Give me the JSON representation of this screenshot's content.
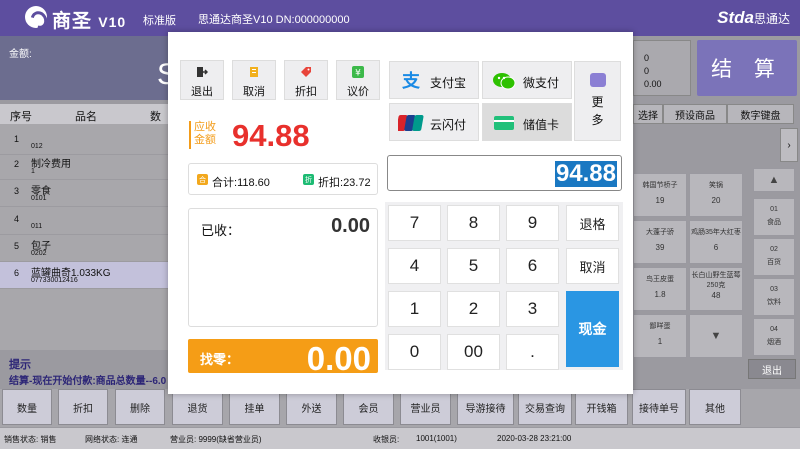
{
  "topbar": {
    "brand": "商圣",
    "version": "V10",
    "edition": "标准版",
    "title": "思通达商圣V10 DN:000000000",
    "logo_right": "Stda",
    "logo_right_cn": "思通达"
  },
  "background": {
    "amount_label": "金额:",
    "amount_partial": "S",
    "list_headers": {
      "seq": "序号",
      "name": "品名",
      "qty": "数量"
    },
    "rows": [
      {
        "no": "1",
        "name": "",
        "code": "012"
      },
      {
        "no": "2",
        "name": "制冷费用",
        "code": "1"
      },
      {
        "no": "3",
        "name": "零食",
        "code": "0101"
      },
      {
        "no": "4",
        "name": "",
        "code": "011"
      },
      {
        "no": "5",
        "name": "包子",
        "code": "0202"
      },
      {
        "no": "6",
        "name": "蓝罐曲奇1.033KG",
        "code": "077330012416"
      }
    ],
    "tips_title": "提示",
    "tips_text": "结算-现在开始付款:商品总数量--6.0",
    "right_total": {
      "a": "0",
      "b": "0",
      "c": "0.00"
    },
    "checkout_label": "结 算",
    "right_tabs": [
      "选择",
      "预设商品",
      "数字键盘"
    ],
    "right_side_arrow": "›",
    "products": [
      {
        "name": "韩国节桥子",
        "code": "19"
      },
      {
        "name": "笑锅",
        "code": "20"
      },
      {
        "name": "大蓬子骄",
        "code": "39"
      },
      {
        "name": "鸡肠35年大红枣",
        "code": "6"
      },
      {
        "name": "鸟王皮蛋",
        "code": "1.8"
      },
      {
        "name": "长白山野生蓝莓250克",
        "code": "48"
      },
      {
        "name": "鄙咩蛋",
        "code": "1"
      }
    ],
    "categories": [
      {
        "no": "01",
        "label": "食品"
      },
      {
        "no": "02",
        "label": "百货"
      },
      {
        "no": "03",
        "label": "饮料"
      },
      {
        "no": "04",
        "label": "烟酒"
      }
    ],
    "up_arrow": "▲",
    "down_arrow": "▼",
    "exit_right": "退出"
  },
  "function_keys": [
    "数量",
    "折扣",
    "删除",
    "退货",
    "挂单",
    "外送",
    "会员",
    "营业员",
    "导游接待",
    "交易查询",
    "开钱箱",
    "接待单号",
    "其他"
  ],
  "statusbar": {
    "sales_status": "销售状态: 销售",
    "network_status": "网络状态: 连通",
    "clerk": "营业员: 9999(缺省营业员)",
    "cashier_label": "收银员:",
    "cashier": "1001(1001)",
    "datetime": "2020-03-28 23:21:00"
  },
  "modal": {
    "toolbar": [
      {
        "icon": "exit-icon",
        "label": "退出"
      },
      {
        "icon": "cancel-icon",
        "label": "取消"
      },
      {
        "icon": "tag-icon",
        "label": "折扣"
      },
      {
        "icon": "yuan-icon",
        "label": "议价"
      }
    ],
    "due_label_line1": "应收",
    "due_label_line2": "金额",
    "due_amount": "94.88",
    "total_label": "合计:",
    "total_value": "118.60",
    "discount_label": "折扣:",
    "discount_value": "23.72",
    "total_badge": "合",
    "discount_badge": "折",
    "received_label": "已收：",
    "received_value": "0.00",
    "change_label": "找零：",
    "change_value": "0.00",
    "payments": [
      {
        "icon": "alipay-icon",
        "label": "支付宝",
        "color": "#1a8ae5"
      },
      {
        "icon": "wechat-icon",
        "label": "微支付",
        "color": "#2dc100"
      },
      {
        "icon": "unionpay-icon",
        "label": "云闪付",
        "color": "#d8232a"
      },
      {
        "icon": "card-icon",
        "label": "储值卡",
        "color": "#21c07a"
      }
    ],
    "more_label": "更多",
    "input_value": "94.88",
    "keys": [
      "7",
      "8",
      "9",
      "4",
      "5",
      "6",
      "1",
      "2",
      "3",
      "0",
      "00",
      "."
    ],
    "backspace_label": "退格",
    "cancel_label": "取消",
    "cash_label": "现金"
  }
}
